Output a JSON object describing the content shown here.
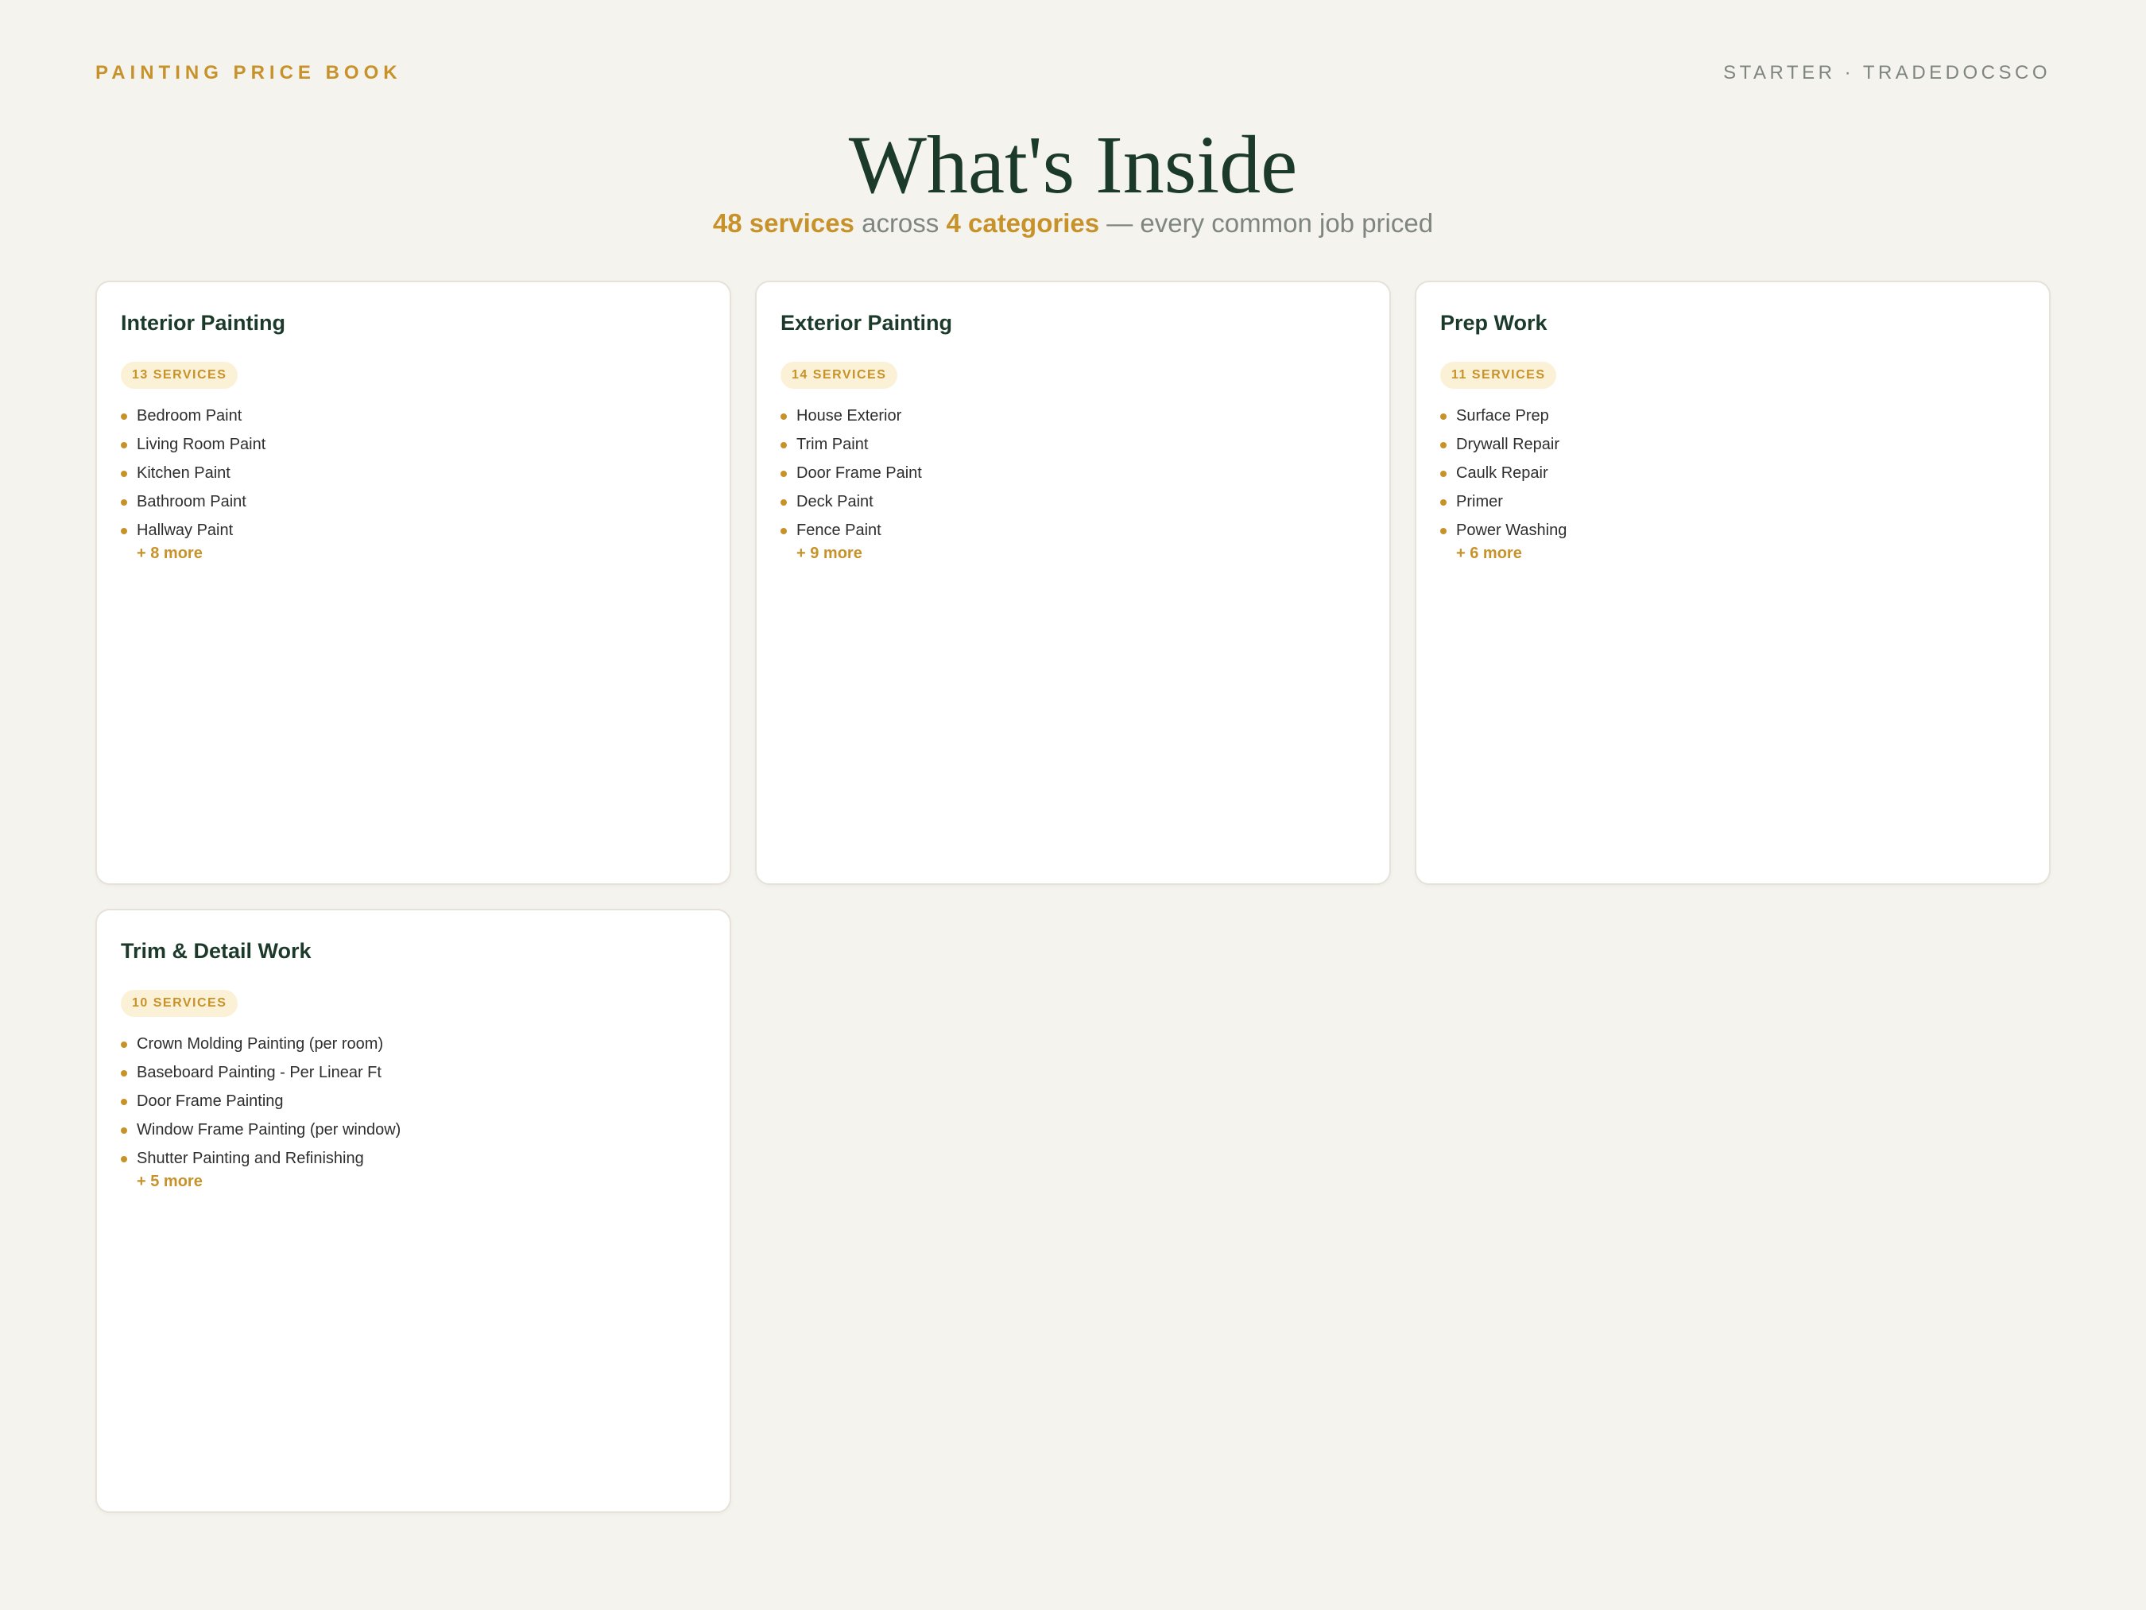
{
  "header": {
    "brand": "PAINTING PRICE BOOK",
    "tier": "STARTER · TRADEDOCSCO"
  },
  "hero": {
    "title": "What's Inside",
    "services_count": "48 services",
    "across": "across",
    "categories_count": "4 categories",
    "tagline": "— every common job priced"
  },
  "cards": [
    {
      "title": "Interior Painting",
      "badge": "13 SERVICES",
      "items": [
        "Bedroom Paint",
        "Living Room Paint",
        "Kitchen Paint",
        "Bathroom Paint",
        "Hallway Paint"
      ],
      "more": "+ 8 more"
    },
    {
      "title": "Exterior Painting",
      "badge": "14 SERVICES",
      "items": [
        "House Exterior",
        "Trim Paint",
        "Door Frame Paint",
        "Deck Paint",
        "Fence Paint"
      ],
      "more": "+ 9 more"
    },
    {
      "title": "Prep Work",
      "badge": "11 SERVICES",
      "items": [
        "Surface Prep",
        "Drywall Repair",
        "Caulk Repair",
        "Primer",
        "Power Washing"
      ],
      "more": "+ 6 more"
    },
    {
      "title": "Trim & Detail Work",
      "badge": "10 SERVICES",
      "items": [
        "Crown Molding Painting (per room)",
        "Baseboard Painting - Per Linear Ft",
        "Door Frame Painting",
        "Window Frame Painting (per window)",
        "Shutter Painting and Refinishing"
      ],
      "more": "+ 5 more"
    }
  ],
  "colors": {
    "accent": "#c8922a",
    "heading": "#1c3a2a",
    "muted": "#7f857f",
    "background": "#f4f3ee"
  }
}
